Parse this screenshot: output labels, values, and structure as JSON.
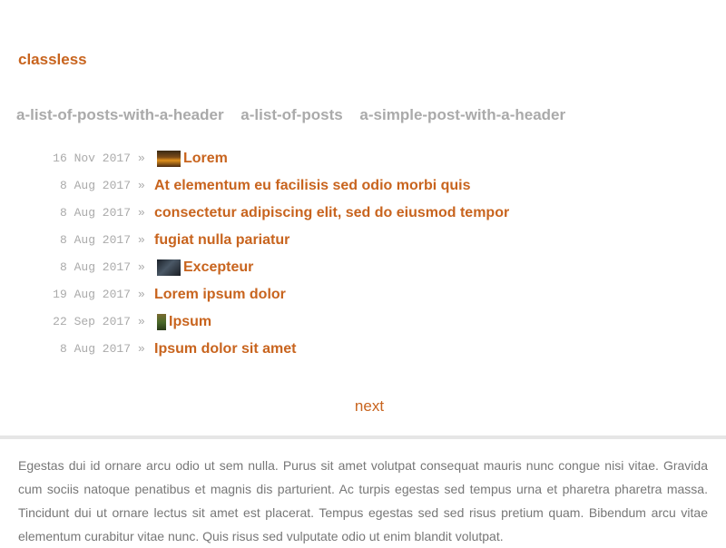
{
  "site": {
    "title": "classless"
  },
  "nav": {
    "items": [
      {
        "label": "a-list-of-posts-with-a-header"
      },
      {
        "label": "a-list-of-posts"
      },
      {
        "label": "a-simple-post-with-a-header"
      }
    ]
  },
  "posts": [
    {
      "date": "16 Nov 2017",
      "sep": "»",
      "title": "Lorem",
      "thumbnail": "sunset-thumbnail"
    },
    {
      "date": "8 Aug 2017",
      "sep": "»",
      "title": "At elementum eu facilisis sed odio morbi quis"
    },
    {
      "date": "8 Aug 2017",
      "sep": "»",
      "title": "consectetur adipiscing elit, sed do eiusmod tempor"
    },
    {
      "date": "8 Aug 2017",
      "sep": "»",
      "title": "fugiat nulla pariatur"
    },
    {
      "date": "8 Aug 2017",
      "sep": "»",
      "title": "Excepteur",
      "thumbnail": "dark-thumbnail"
    },
    {
      "date": "19 Aug 2017",
      "sep": "»",
      "title": "Lorem ipsum dolor"
    },
    {
      "date": "22 Sep 2017",
      "sep": "»",
      "title": "Ipsum",
      "thumbnail": "plant-thumbnail"
    },
    {
      "date": "8 Aug 2017",
      "sep": "»",
      "title": "Ipsum dolor sit amet"
    }
  ],
  "pager": {
    "next_label": "next"
  },
  "footer": {
    "text": "Egestas dui id ornare arcu odio ut sem nulla. Purus sit amet volutpat consequat mauris nunc congue nisi vitae. Gravida cum sociis natoque penatibus et magnis dis parturient. Ac turpis egestas sed tempus urna et pharetra pharetra massa. Tincidunt dui ut ornare lectus sit amet est placerat. Tempus egestas sed sed risus pretium quam. Bibendum arcu vitae elementum curabitur vitae nunc. Quis risus sed vulputate odio ut enim blandit volutpat."
  },
  "colors": {
    "accent": "#c8641e",
    "muted": "#aaaaaa",
    "body_text": "#777777",
    "divider": "#e6e6e6"
  }
}
